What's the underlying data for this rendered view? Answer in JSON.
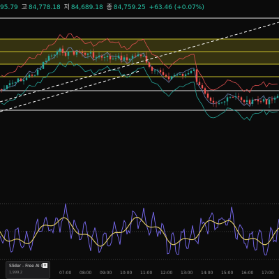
{
  "header": {
    "open_partial": "95.79",
    "high_label": "고",
    "high": "84,778.18",
    "low_label": "저",
    "low": "84,689.18",
    "close_label": "종",
    "close": "84,759.25",
    "change": "+63.46 (+0.07%)"
  },
  "colors": {
    "background": "#0b0b0b",
    "up_candle": "#26a69a",
    "down_candle": "#ef5350",
    "bollinger_upper": "#e05050",
    "bollinger_lower": "#26a69a",
    "level_yellow": "#c9c02a",
    "level_white": "#e6e6e6",
    "trendline": "#ffffff",
    "oscillator_fast": "#7b6cf6",
    "oscillator_slow": "#e9d36a"
  },
  "time_axis": {
    "labels": [
      "07:00",
      "08:00",
      "09:00",
      "10:00",
      "11:00",
      "12:00",
      "13:00",
      "14:00",
      "15:00",
      "16:00",
      "17:00"
    ]
  },
  "widget": {
    "title": "Slider - Free AI G",
    "subtitle": "1,999.2",
    "close_icon": "close-icon"
  }
}
